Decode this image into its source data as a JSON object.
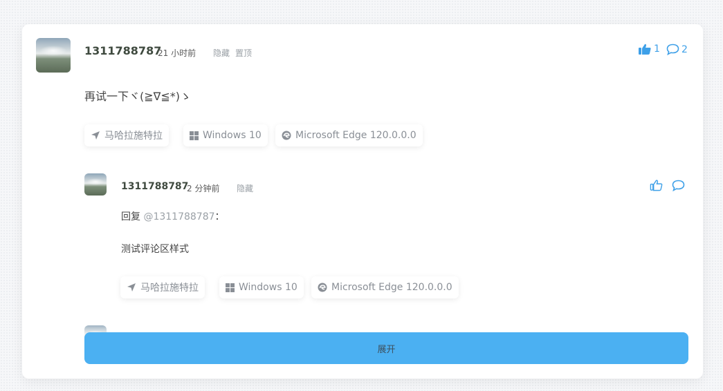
{
  "comment": {
    "username": "1311788787",
    "time": "21 小时前",
    "actions": {
      "hide": "隐藏",
      "pin": "置顶"
    },
    "likes": "1",
    "replies": "2",
    "content": "再试一下ヾ(≧∇≦*)ゝ",
    "tags": {
      "location": "马哈拉施特拉",
      "os": "Windows 10",
      "browser": "Microsoft Edge 120.0.0.0"
    }
  },
  "reply": {
    "username": "1311788787",
    "time": "2 分钟前",
    "actions": {
      "hide": "隐藏"
    },
    "reply_prefix": "回复",
    "reply_to": "@1311788787",
    "reply_colon": "：",
    "content": "测试评论区样式",
    "tags": {
      "location": "马哈拉施特拉",
      "os": "Windows 10",
      "browser": "Microsoft Edge 120.0.0.0"
    }
  },
  "expand_label": "展开",
  "colors": {
    "accent": "#3ea0e8",
    "expand_bg": "#4bb0f2"
  },
  "icons": [
    "location-arrow-icon",
    "windows-icon",
    "edge-icon",
    "thumbs-up-icon",
    "comment-icon"
  ]
}
